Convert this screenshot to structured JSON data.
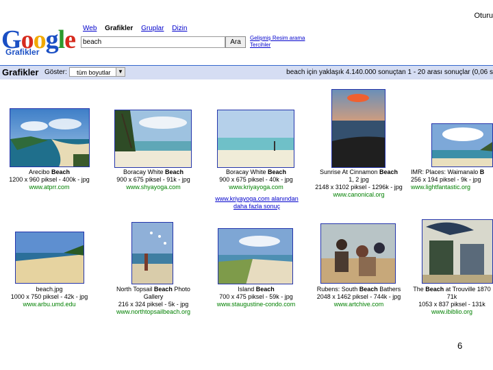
{
  "header": {
    "signin": "Oturu",
    "logo_word": [
      "G",
      "o",
      "o",
      "g",
      "l",
      "e"
    ],
    "logo_sub": "Grafikler",
    "nav": [
      {
        "label": "Web",
        "current": false
      },
      {
        "label": "Grafikler",
        "current": true
      },
      {
        "label": "Gruplar",
        "current": false
      },
      {
        "label": "Dizin",
        "current": false
      }
    ],
    "search_value": "beach",
    "search_button": "Ara",
    "advanced_link": "Gelişmiş Resim arama",
    "prefs_link": "Tercihler"
  },
  "bar": {
    "title": "Grafikler",
    "show_label": "Göster:",
    "show_value": "tüm boyutlar",
    "stats": "beach için yaklaşık 4.140.000 sonuçtan 1 - 20 arası sonuçlar (0,06 s"
  },
  "results": [
    {
      "title": "Arecibo Beach",
      "bold": "Beach",
      "meta": "1200 x 960 piksel - 400k - jpg",
      "url": "www.atprr.com"
    },
    {
      "title": "Boracay White Beach",
      "bold": "Beach",
      "meta": "900 x 675 piksel - 91k - jpg",
      "url": "www.shyayoga.com"
    },
    {
      "title": "Boracay White Beach",
      "bold": "Beach",
      "meta": "900 x 675 piksel - 40k - jpg",
      "url": "www.kriyayoga.com"
    },
    {
      "title": "Sunrise At Cinnamon Beach",
      "bold": "Beach",
      "meta": "2148 x 3102 piksel - 1296k - jpg",
      "url": "www.canonical.org",
      "meta_top": "1, 2 jpg"
    },
    {
      "title": "IMR: Places: Waimanalo B",
      "bold": "B",
      "meta": "256 x 194 piksel - 9k - jpg",
      "url": "www.lightfantastic.org"
    },
    {
      "title": "beach.jpg",
      "bold": "",
      "meta": "1000 x 750 piksel - 42k - jpg",
      "url": "www.arbu.umd.edu"
    },
    {
      "title": "North Topsail Beach Photo Gallery",
      "bold": "Beach",
      "meta": "216 x 324 piksel - 5k - jpg",
      "url": "www.northtopsailbeach.org"
    },
    {
      "title": "Island Beach",
      "bold": "Beach",
      "meta": "700 x 475 piksel - 59k - jpg",
      "url": "www.staugustine-condo.com"
    },
    {
      "title": "Rubens: South Beach Bathers",
      "bold": "Beach",
      "meta": "2048 x 1462 piksel - 744k - jpg",
      "url": "www.artchive.com"
    },
    {
      "title": "The Beach at Trouville 1870",
      "bold": "Beach",
      "meta": "1053 x 837 piksel - 131k",
      "url": "www.ibiblio.org",
      "extra": "71k"
    }
  ],
  "more": {
    "line1": "www.kriyayoga.com alanından",
    "line2": "daha fazla sonuç"
  },
  "page_number": "6"
}
